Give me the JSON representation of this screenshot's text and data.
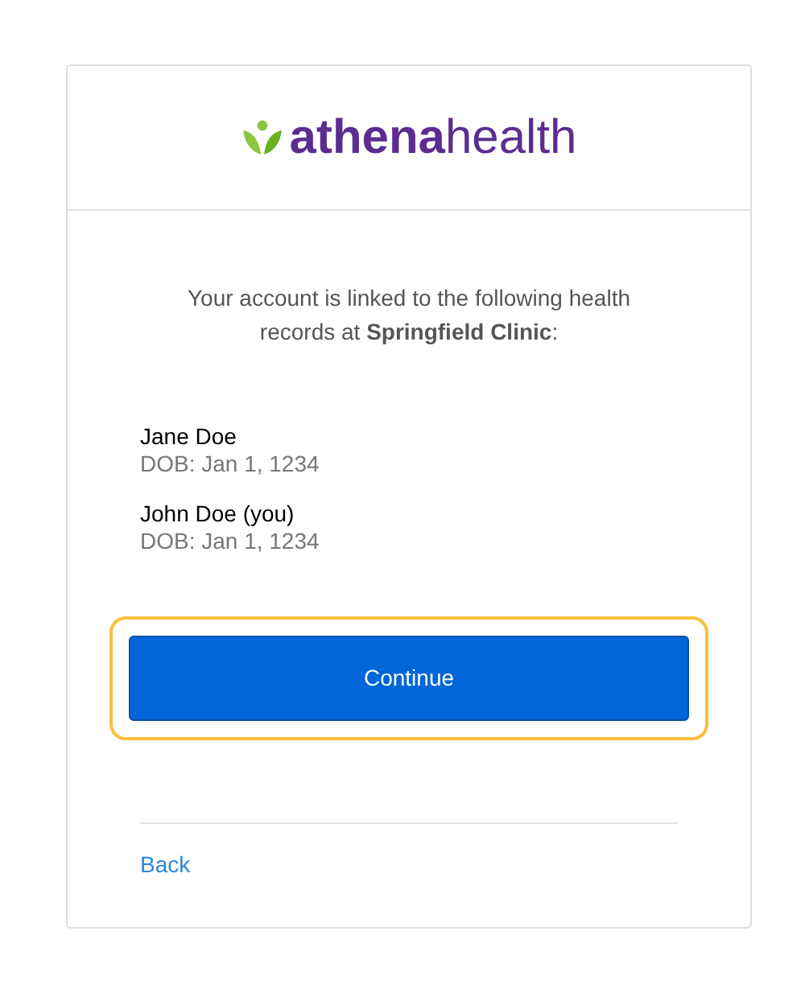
{
  "logo": {
    "text": "**athena**health"
  },
  "message": "Your account is linked to the following health records at **Springfield Clinic**:",
  "records": [
    {
      "name": "Jane Doe",
      "dob": "DOB: Jan 1, 1234"
    },
    {
      "name": "John Doe (you)",
      "dob": "DOB: Jan 1, 1234"
    }
  ],
  "continue_button": {
    "label": "Continue",
    "focused": true
  },
  "back_link": {
    "label": "Back"
  }
}
